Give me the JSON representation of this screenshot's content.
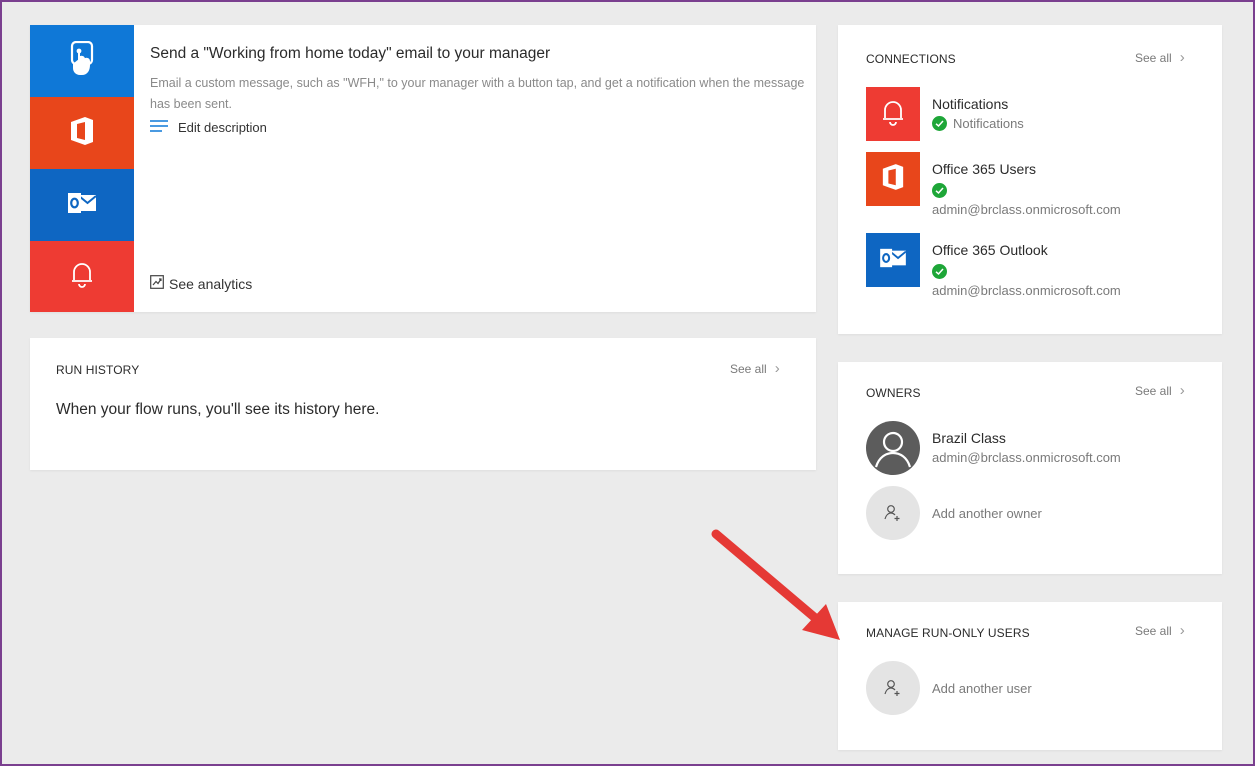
{
  "flow": {
    "title": "Send a \"Working from home today\" email to your manager",
    "description": "Email a custom message, such as \"WFH,\" to your manager with a button tap, and get a notification when the message has been sent.",
    "edit_description_label": "Edit description",
    "analytics_label": "See analytics",
    "tiles": [
      {
        "icon": "button-tap-icon",
        "color": "#0f78d7"
      },
      {
        "icon": "office-icon",
        "color": "#e8461b"
      },
      {
        "icon": "outlook-icon",
        "color": "#0e66c2"
      },
      {
        "icon": "bell-icon",
        "color": "#ee3b33"
      }
    ]
  },
  "run_history": {
    "title": "RUN HISTORY",
    "see_all": "See all",
    "empty_message": "When your flow runs, you'll see its history here."
  },
  "connections": {
    "title": "CONNECTIONS",
    "see_all": "See all",
    "items": [
      {
        "name": "Notifications",
        "status_text": "Notifications",
        "icon": "bell-icon",
        "color": "#ee3b33"
      },
      {
        "name": "Office 365 Users",
        "account": "admin@brclass.onmicrosoft.com",
        "icon": "office-icon",
        "color": "#e8461b"
      },
      {
        "name": "Office 365 Outlook",
        "account": "admin@brclass.onmicrosoft.com",
        "icon": "outlook-icon",
        "color": "#0e66c2"
      }
    ],
    "status_color": "#1ea638"
  },
  "owners": {
    "title": "OWNERS",
    "see_all": "See all",
    "owner": {
      "name": "Brazil Class",
      "email": "admin@brclass.onmicrosoft.com"
    },
    "add_label": "Add another owner"
  },
  "run_only": {
    "title": "MANAGE RUN-ONLY USERS",
    "see_all": "See all",
    "add_label": "Add another user"
  },
  "annotation": {
    "arrow_color": "#e53935"
  }
}
